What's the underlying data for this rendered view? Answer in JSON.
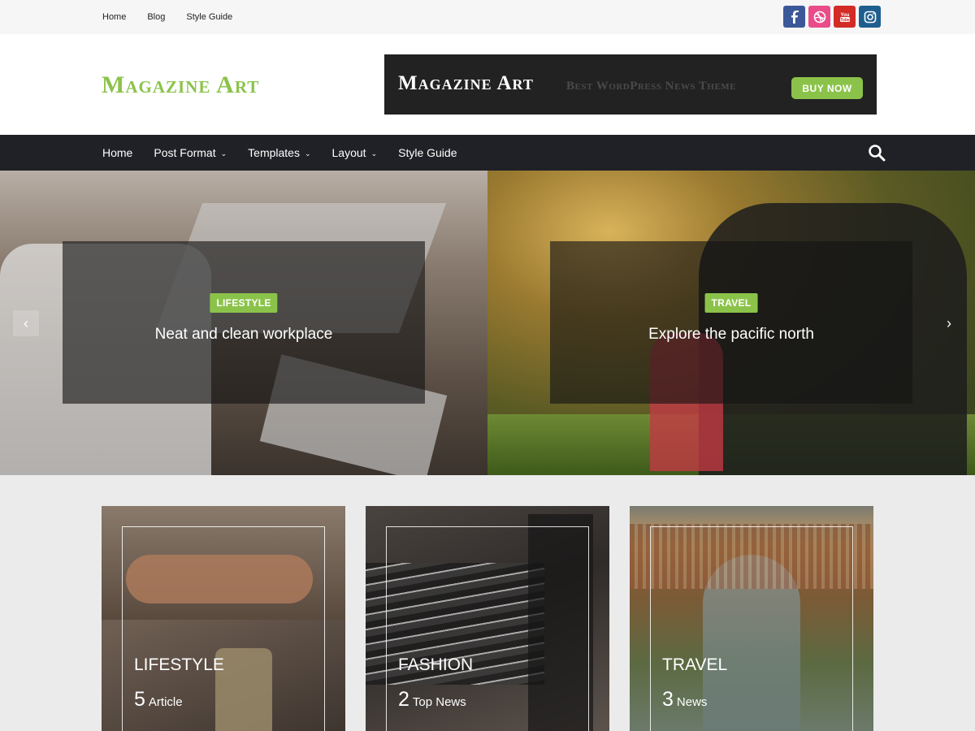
{
  "top_nav": {
    "items": [
      "Home",
      "Blog",
      "Style Guide"
    ]
  },
  "social": {
    "icons": [
      "facebook-icon",
      "dribbble-icon",
      "youtube-icon",
      "instagram-icon"
    ],
    "colors": [
      "#3b5998",
      "#ea4c89",
      "#d32b26",
      "#1f5f8f"
    ]
  },
  "header": {
    "logo": "Magazine Art",
    "banner": {
      "name": "Magazine Art",
      "tagline": "Best WordPress News Theme",
      "button": "BUY NOW"
    }
  },
  "main_nav": {
    "items": [
      {
        "label": "Home"
      },
      {
        "label": "Post Format"
      },
      {
        "label": "Templates"
      },
      {
        "label": "Layout"
      },
      {
        "label": "Style Guide"
      }
    ]
  },
  "slider": {
    "slides": [
      {
        "category": "LIFESTYLE",
        "title": "Neat and clean workplace"
      },
      {
        "category": "TRAVEL",
        "title": "Explore the pacific north"
      }
    ]
  },
  "categories": [
    {
      "name": "LIFESTYLE",
      "count": "5",
      "label": "Article"
    },
    {
      "name": "FASHION",
      "count": "2",
      "label": "Top News"
    },
    {
      "name": "TRAVEL",
      "count": "3",
      "label": "News"
    }
  ],
  "colors": {
    "accent": "#8bc34a",
    "nav_bg": "#1f2126",
    "banner_bg": "#222222"
  }
}
